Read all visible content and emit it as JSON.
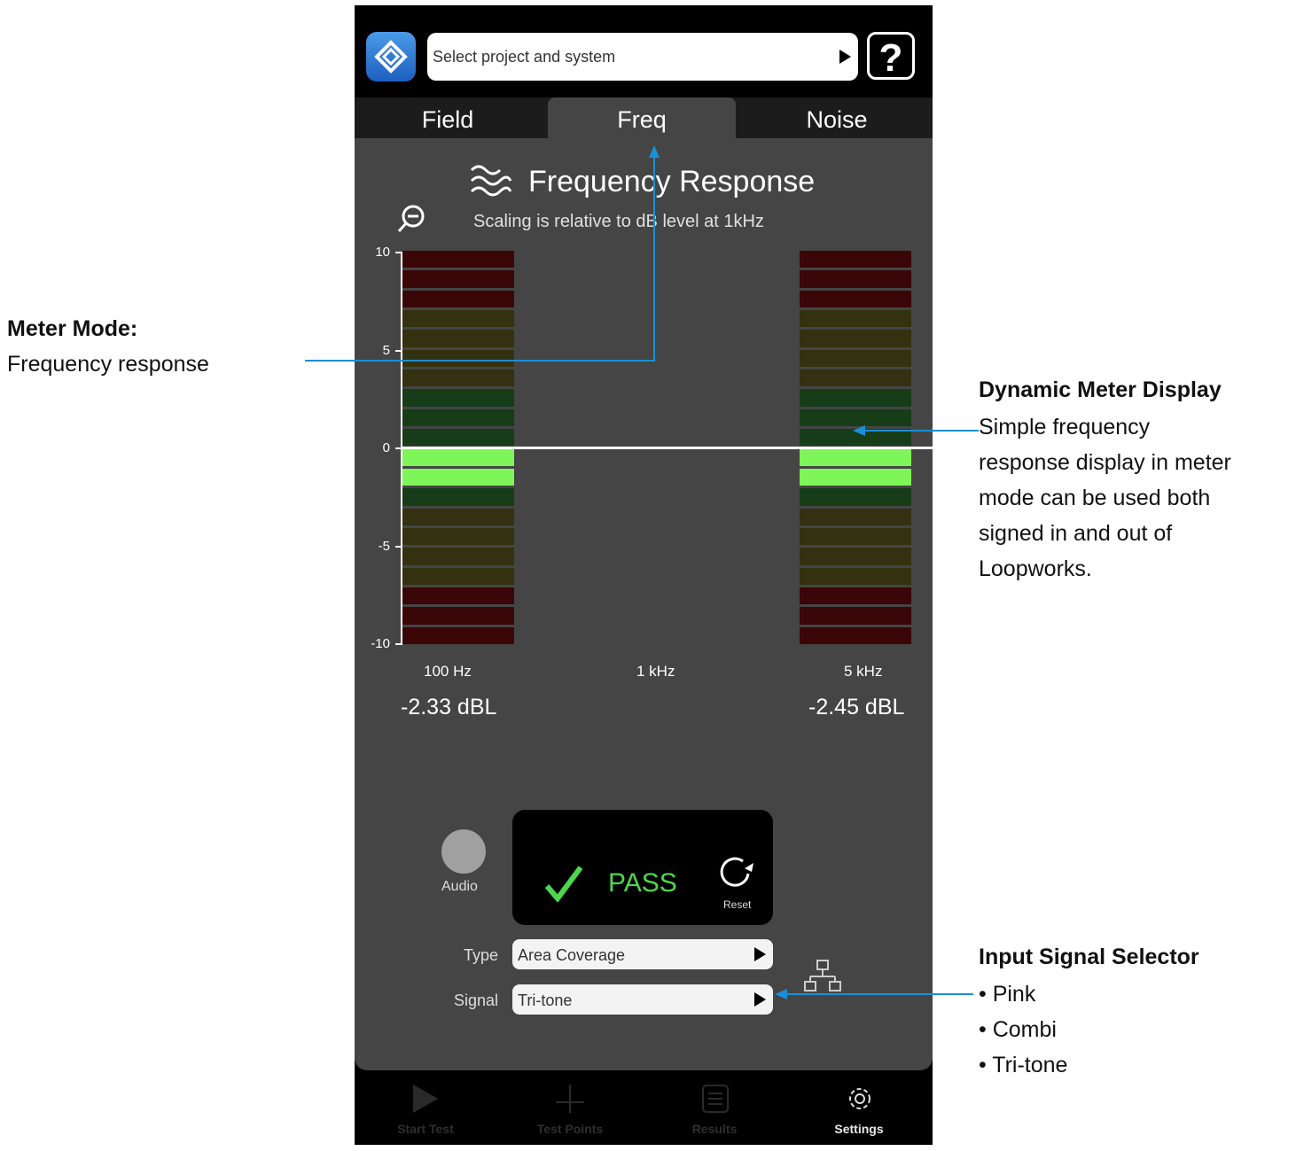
{
  "annotations": {
    "meter_mode": {
      "title": "Meter Mode:",
      "text": "Frequency response"
    },
    "dynamic_meter": {
      "title": "Dynamic Meter Display",
      "lines": [
        "Simple frequency",
        "response display in meter",
        "mode can be used both",
        "signed in and out of",
        "Loopworks."
      ]
    },
    "input_signal": {
      "title": "Input Signal Selector",
      "lines": [
        "• Pink",
        "• Combi",
        "• Tri-tone"
      ]
    }
  },
  "header": {
    "project_placeholder": "Select project and system",
    "help_label": "?"
  },
  "tabs": [
    {
      "label": "Field"
    },
    {
      "label": "Freq"
    },
    {
      "label": "Noise"
    }
  ],
  "panel": {
    "title": "Frequency Response",
    "subtitle": "Scaling is relative to dB level at 1kHz",
    "y_ticks": [
      "10",
      "5",
      "0",
      "-5",
      "-10"
    ],
    "bands": [
      {
        "label": "100 Hz",
        "value_text": "-2.33 dBL",
        "value": -2.33
      },
      {
        "label": "1 kHz",
        "value_text": "",
        "value": 0
      },
      {
        "label": "5 kHz",
        "value_text": "-2.45 dBL",
        "value": -2.45
      }
    ]
  },
  "status": {
    "audio_label": "Audio",
    "result": "PASS",
    "reset_label": "Reset"
  },
  "form": {
    "type_label": "Type",
    "type_value": "Area Coverage",
    "signal_label": "Signal",
    "signal_value": "Tri-tone"
  },
  "bottom_nav": [
    {
      "label": "Start Test",
      "icon": "play-icon",
      "active": false
    },
    {
      "label": "Test Points",
      "icon": "crosshair-icon",
      "active": false
    },
    {
      "label": "Results",
      "icon": "list-icon",
      "active": false
    },
    {
      "label": "Settings",
      "icon": "gear-icon",
      "active": true
    }
  ],
  "colors": {
    "accent": "#1a8fd6",
    "pass": "#4cd84c",
    "meter_red": "#3a0608",
    "meter_yellow": "#33310f",
    "meter_green_dim": "#163d18",
    "meter_green": "#7ef558"
  }
}
